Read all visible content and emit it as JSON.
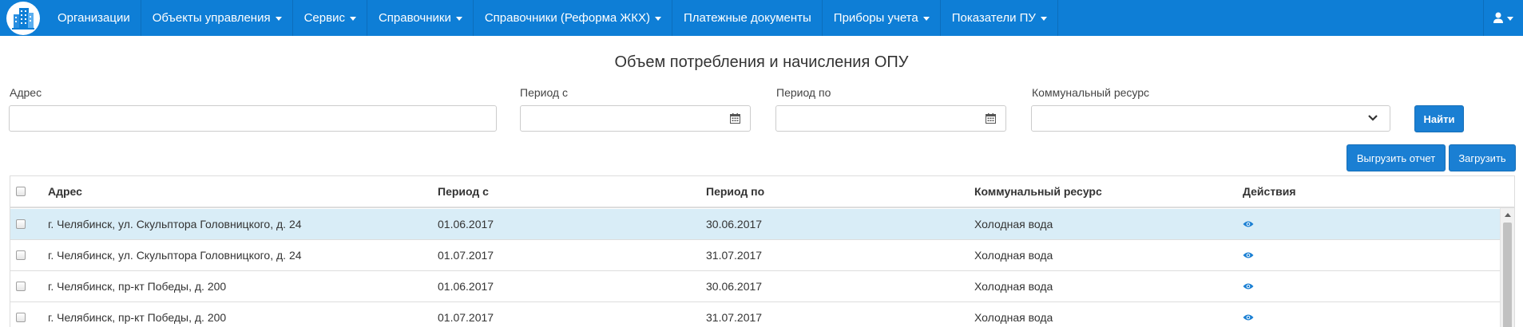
{
  "nav": {
    "logo_icon": "building-logo-icon",
    "items": [
      {
        "label": "Организации",
        "dropdown": false
      },
      {
        "label": "Объекты управления",
        "dropdown": true
      },
      {
        "label": "Сервис",
        "dropdown": true
      },
      {
        "label": "Справочники",
        "dropdown": true
      },
      {
        "label": "Справочники (Реформа ЖКХ)",
        "dropdown": true
      },
      {
        "label": "Платежные документы",
        "dropdown": false
      },
      {
        "label": "Приборы учета",
        "dropdown": true
      },
      {
        "label": "Показатели ПУ",
        "dropdown": true
      }
    ],
    "user_icon": "user-icon"
  },
  "page": {
    "title": "Объем потребления и начисления ОПУ"
  },
  "filters": {
    "address_label": "Адрес",
    "address_value": "",
    "period_from_label": "Период с",
    "period_from_value": "",
    "period_to_label": "Период по",
    "period_to_value": "",
    "resource_label": "Коммунальный ресурс",
    "resource_value": "",
    "find_button": "Найти"
  },
  "actions": {
    "export_button": "Выгрузить отчет",
    "upload_button": "Загрузить"
  },
  "table": {
    "columns": [
      "Адрес",
      "Период с",
      "Период по",
      "Коммунальный ресурс",
      "Действия"
    ],
    "rows": [
      {
        "address": "г. Челябинск, ул. Скульптора Головницкого, д. 24",
        "period_from": "01.06.2017",
        "period_to": "30.06.2017",
        "resource": "Холодная вода",
        "selected": true
      },
      {
        "address": "г. Челябинск, ул. Скульптора Головницкого, д. 24",
        "period_from": "01.07.2017",
        "period_to": "31.07.2017",
        "resource": "Холодная вода",
        "selected": false
      },
      {
        "address": "г. Челябинск, пр-кт Победы, д. 200",
        "period_from": "01.06.2017",
        "period_to": "30.06.2017",
        "resource": "Холодная вода",
        "selected": false
      },
      {
        "address": "г. Челябинск, пр-кт Победы, д. 200",
        "period_from": "01.07.2017",
        "period_to": "31.07.2017",
        "resource": "Холодная вода",
        "selected": false
      }
    ]
  },
  "colors": {
    "navbar": "#0e7ed6",
    "primary_button": "#1a7fd3",
    "selected_row": "#d9edf7",
    "eye_icon": "#1a7fd3"
  }
}
